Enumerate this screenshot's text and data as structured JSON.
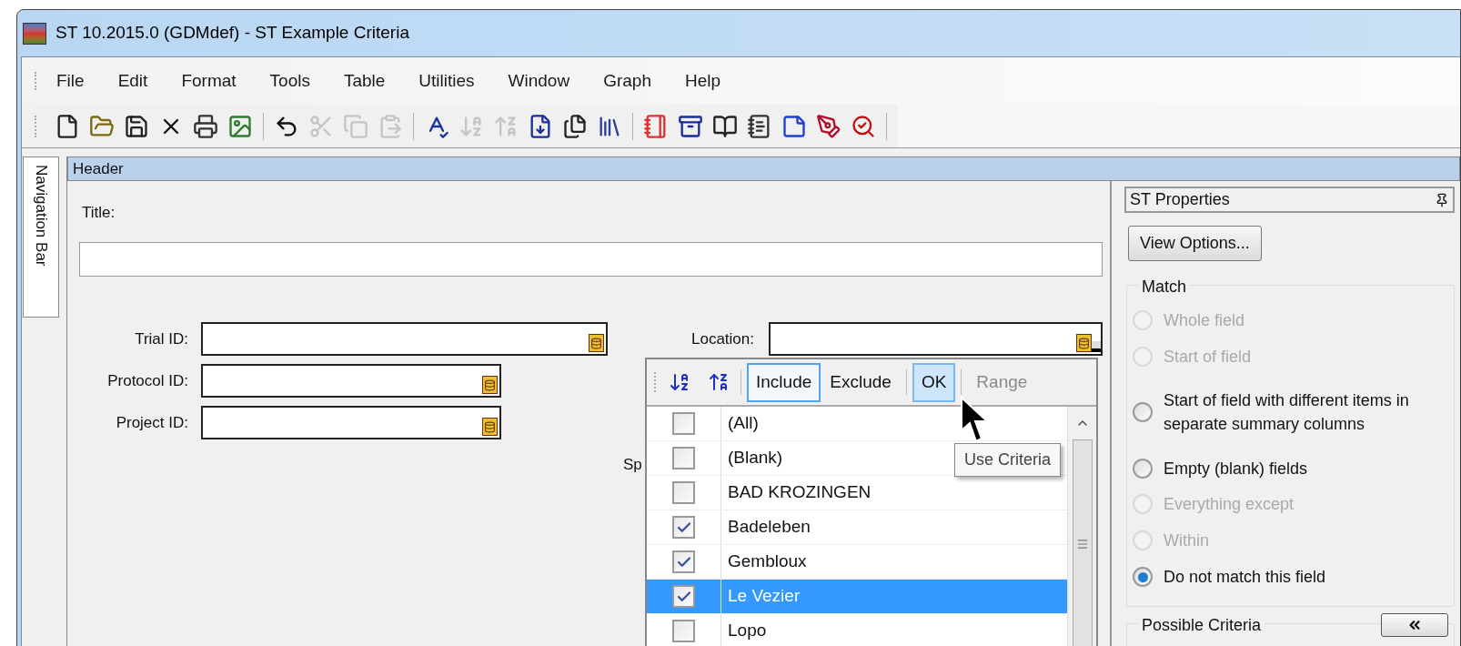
{
  "window": {
    "title": "ST 10.2015.0 (GDMdef) - ST Example Criteria"
  },
  "menu": [
    "File",
    "Edit",
    "Format",
    "Tools",
    "Table",
    "Utilities",
    "Window",
    "Graph",
    "Help"
  ],
  "toolbar": [
    {
      "kind": "new",
      "disabled": false
    },
    {
      "kind": "open",
      "disabled": false
    },
    {
      "kind": "save",
      "disabled": false
    },
    {
      "kind": "delete",
      "disabled": false
    },
    {
      "kind": "print",
      "disabled": false
    },
    {
      "kind": "picture",
      "disabled": false
    },
    {
      "kind": "separator"
    },
    {
      "kind": "undo",
      "disabled": false
    },
    {
      "kind": "cut",
      "disabled": true
    },
    {
      "kind": "copy",
      "disabled": true
    },
    {
      "kind": "paste",
      "disabled": true
    },
    {
      "kind": "separator"
    },
    {
      "kind": "spell",
      "disabled": false
    },
    {
      "kind": "sort_asc",
      "disabled": true
    },
    {
      "kind": "sort_desc",
      "disabled": true
    },
    {
      "kind": "export",
      "disabled": false
    },
    {
      "kind": "files",
      "disabled": false
    },
    {
      "kind": "books",
      "disabled": false
    },
    {
      "kind": "separator"
    },
    {
      "kind": "notebook",
      "disabled": false
    },
    {
      "kind": "drawer",
      "disabled": false
    },
    {
      "kind": "book",
      "disabled": false
    },
    {
      "kind": "journal",
      "disabled": false
    },
    {
      "kind": "notepad",
      "disabled": false
    },
    {
      "kind": "edit",
      "disabled": false
    },
    {
      "kind": "zoom",
      "disabled": false
    },
    {
      "kind": "separator"
    }
  ],
  "navigation_bar": {
    "label": "Navigation Bar"
  },
  "header": {
    "title": "Header"
  },
  "form": {
    "title_label": "Title:",
    "fields": [
      {
        "label": "Trial ID:"
      },
      {
        "label": "Protocol ID:"
      },
      {
        "label": "Project ID:"
      }
    ],
    "location_label": "Location:",
    "partial_label": "Sp"
  },
  "criteria_popup": {
    "buttons": [
      {
        "label": "Include",
        "focused": true,
        "hovered": false,
        "disabled": false
      },
      {
        "label": "Exclude",
        "focused": false,
        "hovered": false,
        "disabled": false
      },
      {
        "label": "OK",
        "focused": false,
        "hovered": true,
        "disabled": false
      },
      {
        "label": "Range",
        "focused": false,
        "hovered": false,
        "disabled": true
      }
    ],
    "items": [
      {
        "label": "(All)",
        "checked": false,
        "selected": false
      },
      {
        "label": "(Blank)",
        "checked": false,
        "selected": false
      },
      {
        "label": "BAD KROZINGEN",
        "checked": false,
        "selected": false
      },
      {
        "label": "Badeleben",
        "checked": true,
        "selected": false
      },
      {
        "label": "Gembloux",
        "checked": true,
        "selected": false
      },
      {
        "label": "Le Vezier",
        "checked": true,
        "selected": true
      },
      {
        "label": "Lopo",
        "checked": false,
        "selected": false
      }
    ],
    "tooltip": "Use Criteria"
  },
  "properties": {
    "title": "ST Properties",
    "view_options": "View Options...",
    "match": {
      "title": "Match",
      "options": [
        {
          "label": "Whole field",
          "selected": false,
          "disabled": true
        },
        {
          "label": "Start of field",
          "selected": false,
          "disabled": true
        },
        {
          "label": "Start of field with different items in separate summary columns",
          "selected": false,
          "disabled": false
        },
        {
          "label": "Empty (blank) fields",
          "selected": false,
          "disabled": false
        },
        {
          "label": "Everything except",
          "selected": false,
          "disabled": true
        },
        {
          "label": "Within",
          "selected": false,
          "disabled": true
        },
        {
          "label": "Do not match this field",
          "selected": true,
          "disabled": false
        }
      ]
    },
    "possible_criteria": {
      "title": "Possible Criteria"
    }
  }
}
